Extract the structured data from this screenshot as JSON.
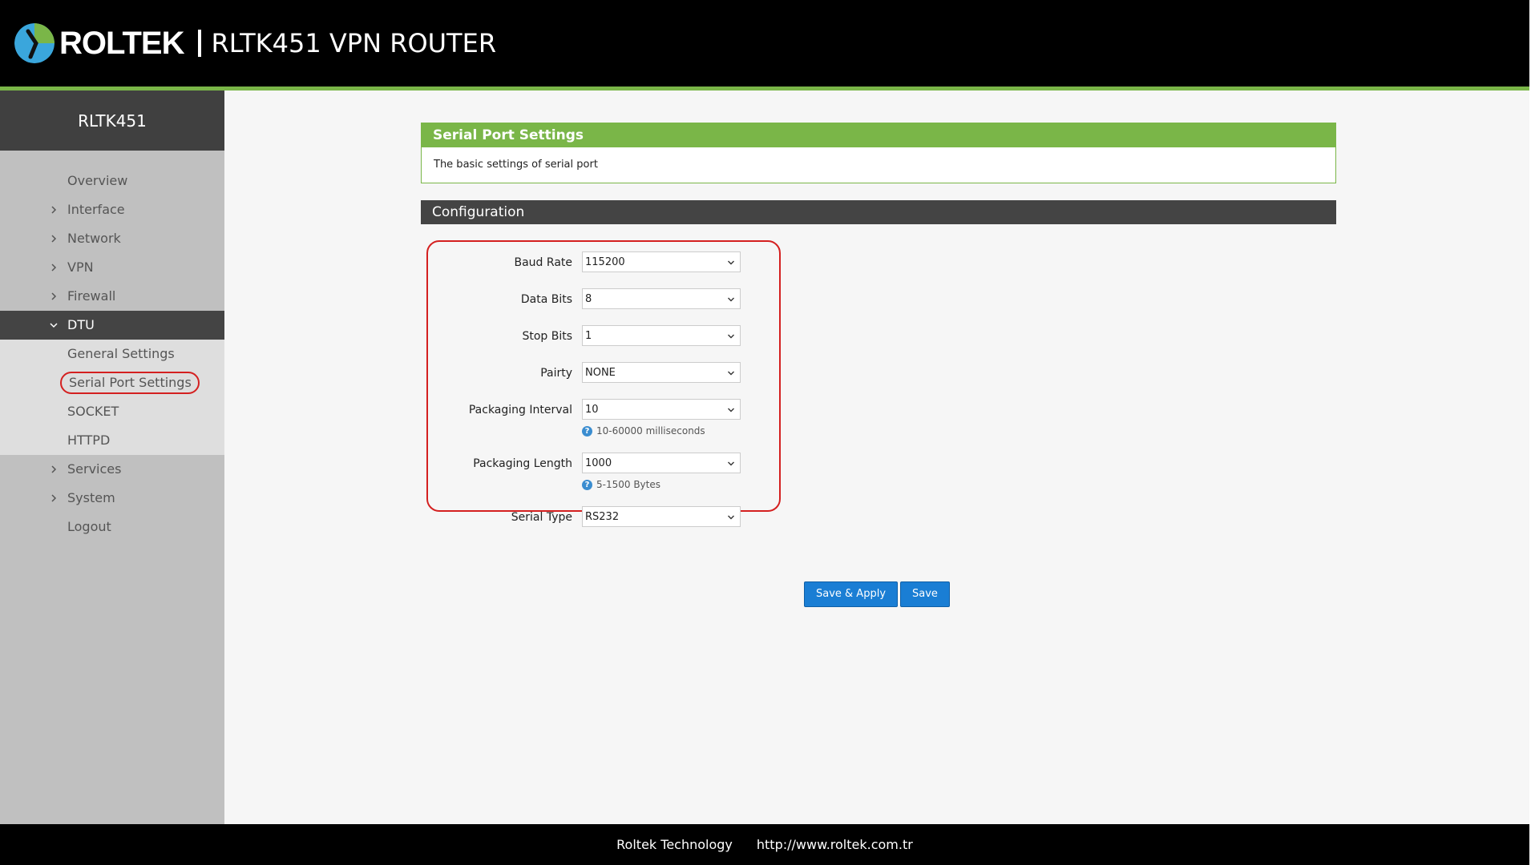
{
  "header": {
    "brand": "ROLTEK",
    "title": "RLTK451 VPN ROUTER"
  },
  "sidebar": {
    "device": "RLTK451",
    "items": [
      {
        "label": "Overview",
        "has_chevron": false
      },
      {
        "label": "Interface",
        "has_chevron": true
      },
      {
        "label": "Network",
        "has_chevron": true
      },
      {
        "label": "VPN",
        "has_chevron": true
      },
      {
        "label": "Firewall",
        "has_chevron": true
      },
      {
        "label": "DTU",
        "has_chevron": true,
        "expanded": true
      },
      {
        "label": "Services",
        "has_chevron": true
      },
      {
        "label": "System",
        "has_chevron": true
      },
      {
        "label": "Logout",
        "has_chevron": false
      }
    ],
    "dtu_sub": [
      {
        "label": "General Settings"
      },
      {
        "label": "Serial Port Settings",
        "selected": true
      },
      {
        "label": "SOCKET"
      },
      {
        "label": "HTTPD"
      }
    ]
  },
  "main": {
    "panel_title": "Serial Port Settings",
    "panel_desc": "The basic settings of serial port",
    "section_title": "Configuration",
    "fields": [
      {
        "label": "Baud Rate",
        "value": "115200"
      },
      {
        "label": "Data Bits",
        "value": "8"
      },
      {
        "label": "Stop Bits",
        "value": "1"
      },
      {
        "label": "Pairty",
        "value": "NONE"
      },
      {
        "label": "Packaging Interval",
        "value": "10",
        "hint": "10-60000 milliseconds"
      },
      {
        "label": "Packaging Length",
        "value": "1000",
        "hint": "5-1500 Bytes"
      },
      {
        "label": "Serial Type",
        "value": "RS232"
      }
    ],
    "buttons": {
      "save_apply": "Save & Apply",
      "save": "Save"
    }
  },
  "footer": {
    "company": "Roltek Technology",
    "url": "http://www.roltek.com.tr"
  },
  "colors": {
    "accent_green": "#7ab648",
    "button_blue": "#1a7ed4",
    "highlight_red": "#d42020"
  }
}
